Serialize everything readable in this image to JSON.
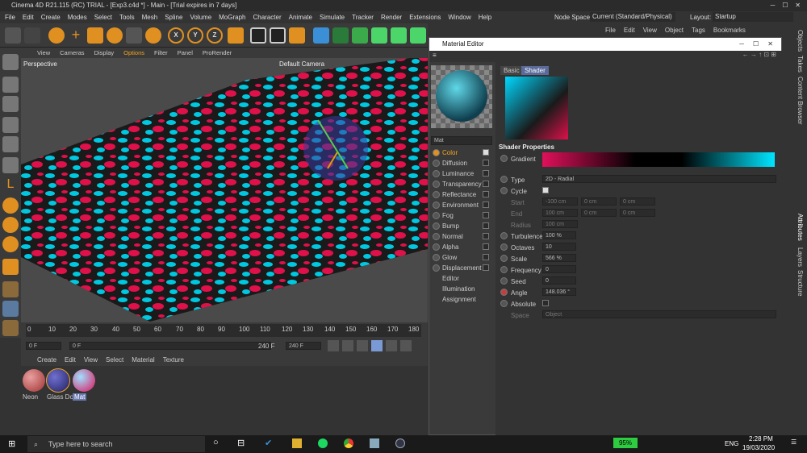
{
  "window": {
    "title": "Cinema 4D R21.115 (RC) TRIAL - [Exp3.c4d *] - Main - [Trial expires in 7 days]"
  },
  "menu": [
    "File",
    "Edit",
    "Create",
    "Modes",
    "Select",
    "Tools",
    "Mesh",
    "Spline",
    "Volume",
    "MoGraph",
    "Character",
    "Animate",
    "Simulate",
    "Tracker",
    "Render",
    "Extensions",
    "Window",
    "Help"
  ],
  "nodespace": {
    "label": "Node Space:",
    "value": "Current (Standard/Physical)"
  },
  "layout": {
    "label": "Layout:",
    "value": "Startup"
  },
  "objmgr_menu": [
    "File",
    "Edit",
    "View",
    "Object",
    "Tags",
    "Bookmarks"
  ],
  "viewport": {
    "menu": [
      "View",
      "Cameras",
      "Display",
      "Options",
      "Filter",
      "Panel",
      "ProRender"
    ],
    "label": "Perspective",
    "camera": "Default Camera"
  },
  "timeline": {
    "ticks": [
      "0",
      "10",
      "20",
      "30",
      "40",
      "50",
      "60",
      "70",
      "80",
      "90",
      "100",
      "110",
      "120",
      "130",
      "140",
      "150",
      "160",
      "170",
      "180"
    ],
    "start": "0 F",
    "current": "0 F",
    "end": "240 F",
    "end2": "240 F"
  },
  "matmgr": {
    "menu": [
      "Create",
      "Edit",
      "View",
      "Select",
      "Material",
      "Texture"
    ],
    "materials": [
      "Neon",
      "Glass Dc",
      "Mat"
    ]
  },
  "mateditor": {
    "title": "Material Editor",
    "name": "Mat",
    "tabs": [
      "Basic",
      "Shader"
    ],
    "section": "Shader Properties",
    "channels": [
      {
        "label": "Color",
        "on": true
      },
      {
        "label": "Diffusion",
        "on": false
      },
      {
        "label": "Luminance",
        "on": false
      },
      {
        "label": "Transparency",
        "on": false
      },
      {
        "label": "Reflectance",
        "on": false
      },
      {
        "label": "Environment",
        "on": false
      },
      {
        "label": "Fog",
        "on": false
      },
      {
        "label": "Bump",
        "on": false
      },
      {
        "label": "Normal",
        "on": false
      },
      {
        "label": "Alpha",
        "on": false
      },
      {
        "label": "Glow",
        "on": false
      },
      {
        "label": "Displacement",
        "on": false
      }
    ],
    "extras": [
      "Editor",
      "Illumination",
      "Assignment"
    ],
    "gradient_label": "Gradient",
    "type": {
      "label": "Type",
      "value": "2D - Radial"
    },
    "cycle": {
      "label": "Cycle"
    },
    "start": {
      "label": "Start",
      "v": [
        "-100 cm",
        "0 cm",
        "0 cm"
      ]
    },
    "end": {
      "label": "End",
      "v": [
        "100 cm",
        "0 cm",
        "0 cm"
      ]
    },
    "radius": {
      "label": "Radius",
      "value": "100 cm"
    },
    "turbulence": {
      "label": "Turbulence",
      "value": "100 %"
    },
    "octaves": {
      "label": "Octaves",
      "value": "10"
    },
    "scale": {
      "label": "Scale",
      "value": "566 %"
    },
    "frequency": {
      "label": "Frequency",
      "value": "0"
    },
    "seed": {
      "label": "Seed",
      "value": "0"
    },
    "angle": {
      "label": "Angle",
      "value": "148.036 °"
    },
    "absolute": {
      "label": "Absolute"
    },
    "space": {
      "label": "Space",
      "value": "Object"
    }
  },
  "rightpanel": [
    "Objects",
    "Takes",
    "Content Browser",
    "Attributes",
    "Layers",
    "Structure"
  ],
  "taskbar": {
    "search": "Type here to search",
    "battery": "95%",
    "lang": "ENG",
    "time": "2:28 PM",
    "date": "19/03/2020"
  },
  "colors": {
    "accent": "#f5a623",
    "cyan": "#00e5ff",
    "magenta": "#ff1a5a"
  }
}
